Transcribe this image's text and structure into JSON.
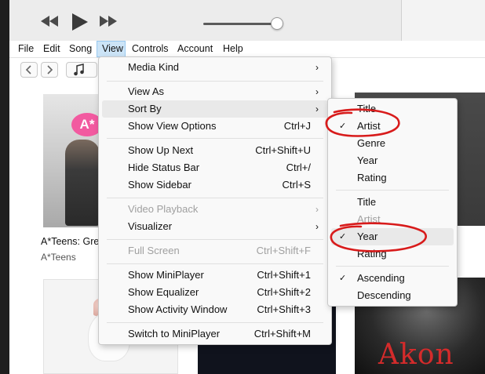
{
  "menubar": {
    "items": [
      "File",
      "Edit",
      "Song",
      "View",
      "Controls",
      "Account",
      "Help"
    ]
  },
  "library": {
    "album_title": "A*Teens: Gre",
    "album_artist": "A*Teens",
    "cover_logo": "A*",
    "cover_akon": "Akon"
  },
  "view_menu": {
    "media_kind": "Media Kind",
    "view_as": "View As",
    "sort_by": "Sort By",
    "show_view_options": "Show View Options",
    "show_view_options_sc": "Ctrl+J",
    "show_up_next": "Show Up Next",
    "show_up_next_sc": "Ctrl+Shift+U",
    "hide_status_bar": "Hide Status Bar",
    "hide_status_bar_sc": "Ctrl+/",
    "show_sidebar": "Show Sidebar",
    "show_sidebar_sc": "Ctrl+S",
    "video_playback": "Video Playback",
    "visualizer": "Visualizer",
    "full_screen": "Full Screen",
    "full_screen_sc": "Ctrl+Shift+F",
    "show_miniplayer": "Show MiniPlayer",
    "show_miniplayer_sc": "Ctrl+Shift+1",
    "show_equalizer": "Show Equalizer",
    "show_equalizer_sc": "Ctrl+Shift+2",
    "show_activity": "Show Activity Window",
    "show_activity_sc": "Ctrl+Shift+3",
    "switch_miniplayer": "Switch to MiniPlayer",
    "switch_miniplayer_sc": "Ctrl+Shift+M"
  },
  "sort_menu": {
    "group1": [
      "Title",
      "Artist",
      "Genre",
      "Year",
      "Rating"
    ],
    "group2": [
      "Title",
      "Artist",
      "Year",
      "Rating"
    ],
    "group3": [
      "Ascending",
      "Descending"
    ],
    "checked": [
      "Artist",
      "Year",
      "Ascending"
    ]
  },
  "colors": {
    "accent": "#cce4f7",
    "annotation": "#d81b1b"
  },
  "icons": [
    "rewind-icon",
    "play-icon",
    "fast-forward-icon",
    "back-icon",
    "forward-icon",
    "music-note-icon",
    "chevron-right-icon",
    "checkmark-icon"
  ]
}
